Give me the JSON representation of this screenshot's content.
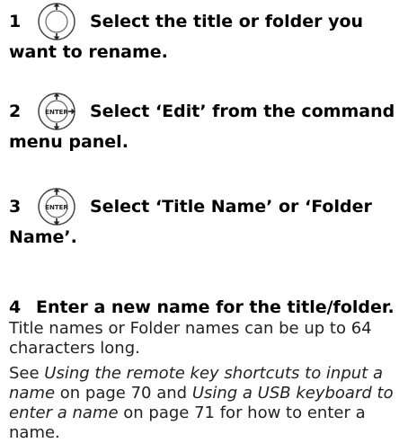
{
  "steps": [
    {
      "number": "1",
      "icon": "up-down-arrow-dial-icon",
      "text": "Select the title or folder you",
      "continuation": "want to rename."
    },
    {
      "number": "2",
      "icon": "enter-right-arrow-dial-icon",
      "text": "Select ‘Edit’ from the command",
      "continuation": "menu panel."
    },
    {
      "number": "3",
      "icon": "enter-up-down-dial-icon",
      "text": "Select ‘Title Name’ or ‘Folder",
      "continuation": "Name’."
    },
    {
      "number": "4",
      "text": "Enter a new name for the title/folder."
    }
  ],
  "paragraph1": {
    "line1": "Title names or Folder names can be up to 64",
    "line2": "characters long."
  },
  "paragraph2": {
    "pre": "See ",
    "link1": "Using the remote key shortcuts to input a name",
    "mid1": " on page 70 and ",
    "link2": "Using a USB keyboard to enter a name",
    "post": " on page 71 for how to enter a name."
  },
  "colors": {
    "text": "#000000",
    "icon_stroke": "#444444",
    "icon_fill": "#ffffff"
  }
}
